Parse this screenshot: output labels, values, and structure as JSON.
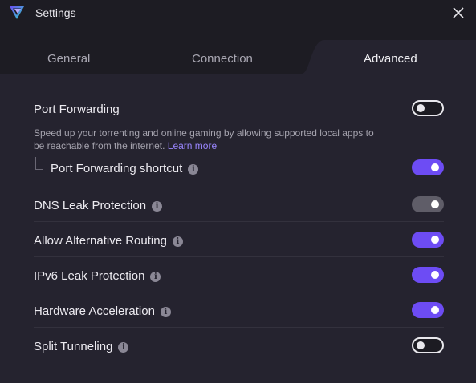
{
  "window": {
    "title": "Settings"
  },
  "tabs": [
    {
      "label": "General",
      "active": false
    },
    {
      "label": "Connection",
      "active": false
    },
    {
      "label": "Advanced",
      "active": true
    }
  ],
  "settings": {
    "port_forwarding": {
      "label": "Port Forwarding",
      "description": "Speed up your torrenting and online gaming by allowing supported local apps to be reachable from the internet.",
      "link": "Learn more",
      "state": "off"
    },
    "port_forwarding_shortcut": {
      "label": "Port Forwarding shortcut",
      "state": "on"
    },
    "dns_leak_protection": {
      "label": "DNS Leak Protection",
      "state": "on-disabled"
    },
    "alternative_routing": {
      "label": "Allow Alternative Routing",
      "state": "on"
    },
    "ipv6_leak_protection": {
      "label": "IPv6 Leak Protection",
      "state": "on"
    },
    "hardware_acceleration": {
      "label": "Hardware Acceleration",
      "state": "on"
    },
    "split_tunneling": {
      "label": "Split Tunneling",
      "state": "off"
    }
  },
  "colors": {
    "accent": "#6d4cf4",
    "link": "#9a86ff",
    "background": "#25232f",
    "titlebar": "#1d1c23"
  },
  "icons": {
    "info": "i",
    "close": "close-icon",
    "logo": "proton-vpn-logo"
  }
}
